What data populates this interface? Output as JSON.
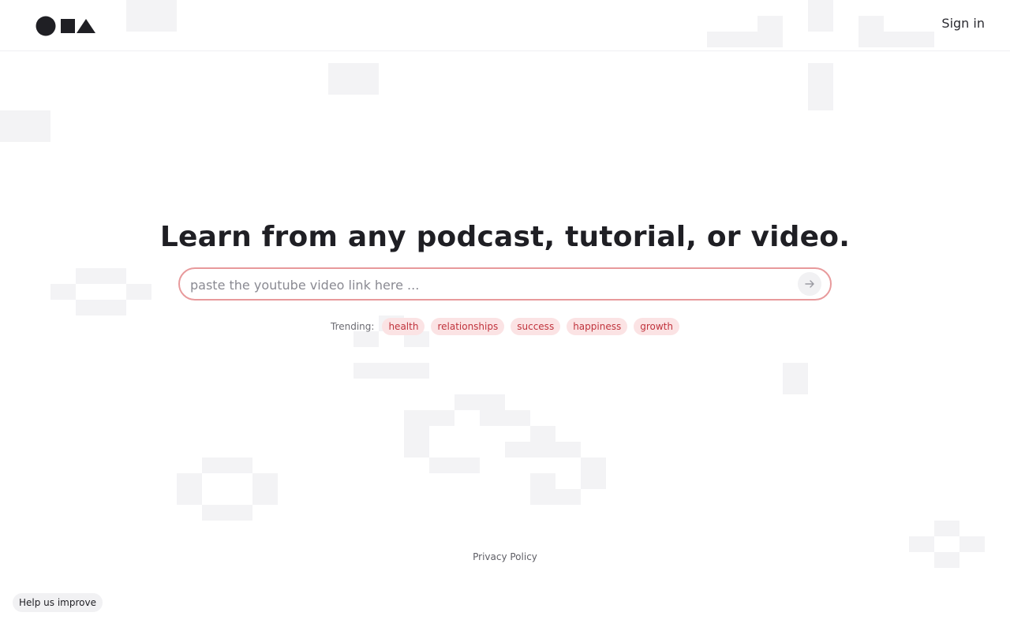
{
  "header": {
    "logo_name": "logo-shapes",
    "signin_label": "Sign in"
  },
  "hero": {
    "title": "Learn from any podcast, tutorial, or video.",
    "search": {
      "placeholder": "paste the youtube video link here ...",
      "value": ""
    }
  },
  "trending": {
    "label": "Trending:",
    "tags": [
      "health",
      "relationships",
      "success",
      "happiness",
      "growth"
    ]
  },
  "footer": {
    "privacy_label": "Privacy Policy",
    "feedback_label": "Help us improve"
  },
  "colors": {
    "accent_border": "#e89a9c",
    "tag_background": "#fbe3e4",
    "tag_text": "#c0333c",
    "pixel_pattern": "#f3f3f5"
  },
  "icons": {
    "submit": "arrow-right-icon"
  }
}
